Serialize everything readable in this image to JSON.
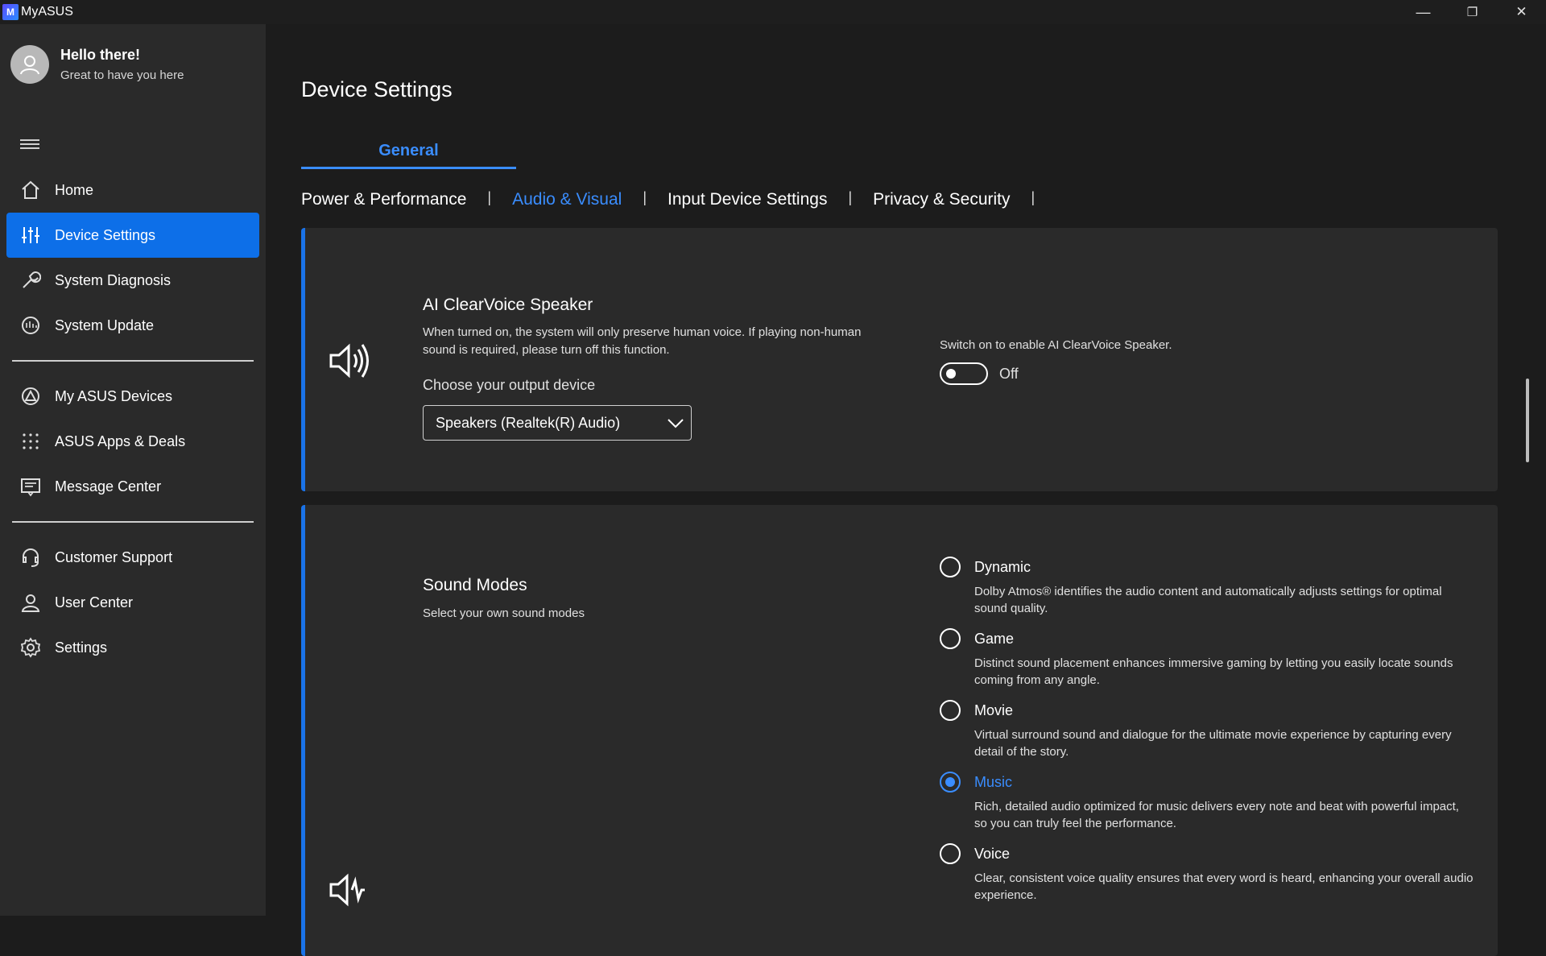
{
  "window": {
    "app_title": "MyASUS",
    "logo_glyph": "M",
    "minimize_glyph": "—",
    "restore_glyph": "❐",
    "close_glyph": "✕"
  },
  "user": {
    "greeting": "Hello there!",
    "subtitle": "Great to have you here"
  },
  "sidebar": {
    "items": [
      {
        "label": "Home",
        "icon": "home-icon"
      },
      {
        "label": "Device Settings",
        "icon": "sliders-icon",
        "active": true
      },
      {
        "label": "System Diagnosis",
        "icon": "wrench-icon"
      },
      {
        "label": "System Update",
        "icon": "update-icon"
      },
      {
        "label": "My ASUS Devices",
        "icon": "devices-icon"
      },
      {
        "label": "ASUS Apps & Deals",
        "icon": "apps-grid-icon"
      },
      {
        "label": "Message Center",
        "icon": "message-icon"
      },
      {
        "label": "Customer Support",
        "icon": "headset-icon"
      },
      {
        "label": "User Center",
        "icon": "user-icon"
      },
      {
        "label": "Settings",
        "icon": "gear-icon"
      }
    ]
  },
  "main": {
    "page_title": "Device Settings",
    "top_tab": "General",
    "subtabs": [
      {
        "label": "Power & Performance"
      },
      {
        "label": "Audio & Visual",
        "active": true
      },
      {
        "label": "Input Device Settings"
      },
      {
        "label": "Privacy & Security"
      }
    ],
    "subtab_separator": "|"
  },
  "clearvoice": {
    "title": "AI ClearVoice Speaker",
    "description": "When turned on, the system will only preserve human voice. If playing non-human sound is required, please turn off this function.",
    "output_label": "Choose your output device",
    "output_device": "Speakers (Realtek(R) Audio)",
    "switch_hint": "Switch on to enable AI ClearVoice Speaker.",
    "switch_state": "Off"
  },
  "sound_modes": {
    "title": "Sound Modes",
    "subtitle": "Select your own sound modes",
    "selected": "Music",
    "options": [
      {
        "label": "Dynamic",
        "desc": "Dolby Atmos® identifies the audio content and automatically adjusts settings for optimal sound quality."
      },
      {
        "label": "Game",
        "desc": "Distinct sound placement enhances immersive gaming by letting you easily locate sounds coming from any angle."
      },
      {
        "label": "Movie",
        "desc": "Virtual surround sound and dialogue for the ultimate movie experience by capturing every detail of the story."
      },
      {
        "label": "Music",
        "desc": "Rich, detailed audio optimized for music delivers every note and beat with powerful impact, so you can truly feel the performance."
      },
      {
        "label": "Voice",
        "desc": "Clear, consistent voice quality ensures that every word is heard, enhancing your overall audio experience."
      }
    ]
  },
  "colors": {
    "accent": "#1a73e8",
    "sidebar_bg": "#2a2a2a",
    "main_bg": "#1c1c1c"
  }
}
